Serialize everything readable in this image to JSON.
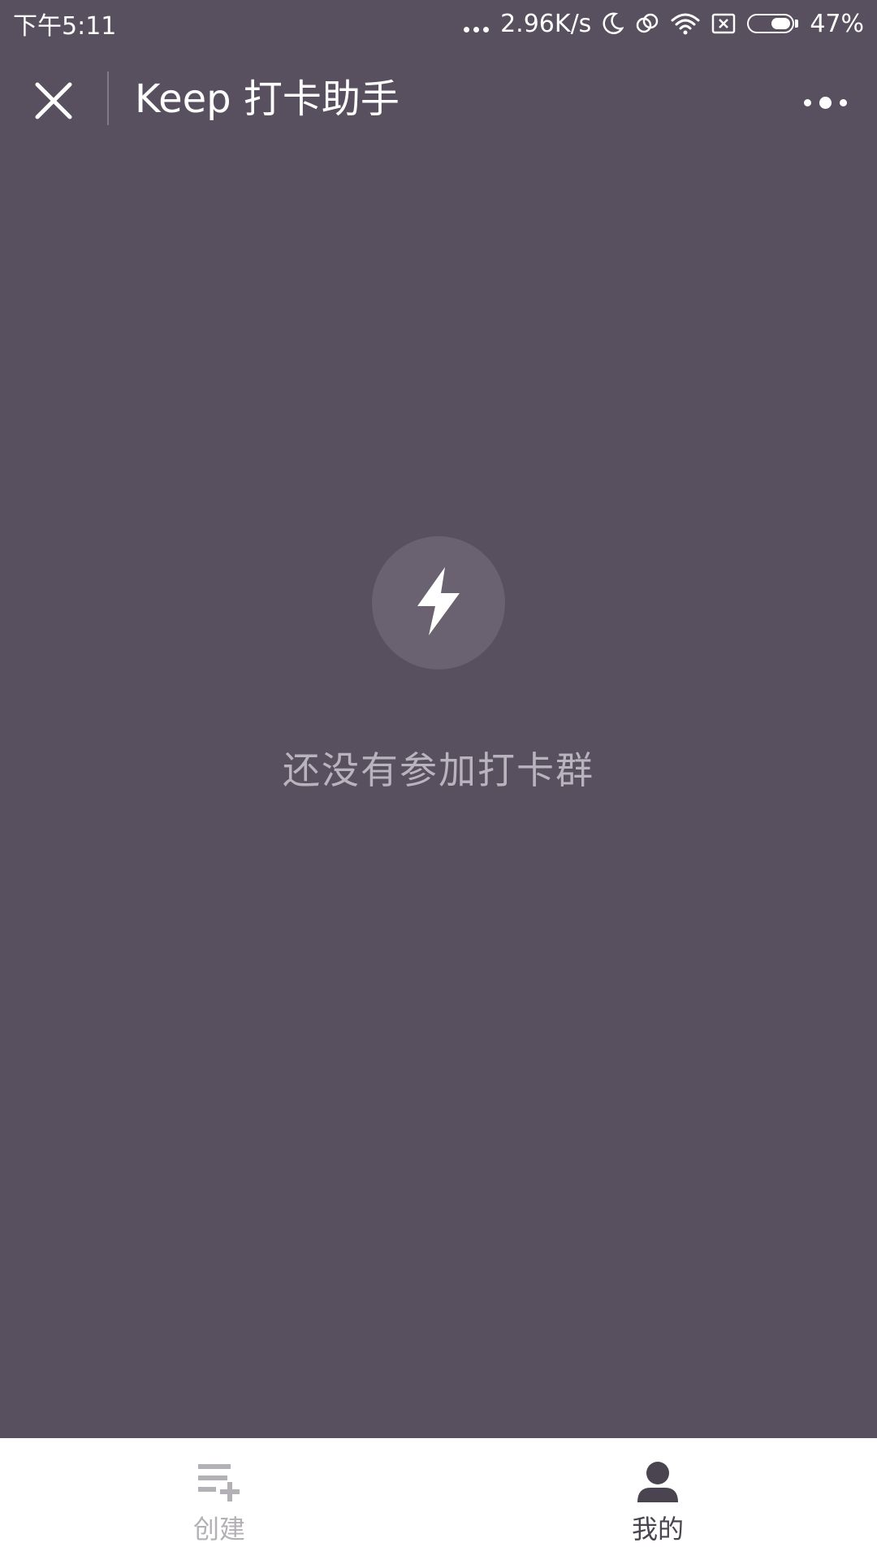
{
  "status_bar": {
    "time": "下午5:11",
    "network_speed": "2.96K/s",
    "battery_percent": "47%",
    "battery_level": 0.47,
    "icons": [
      "more-dots-icon",
      "moon-icon",
      "link-icon",
      "wifi-icon",
      "sim-off-icon",
      "battery-icon"
    ]
  },
  "nav": {
    "title": "Keep 打卡助手",
    "close_icon": "close-icon",
    "more_icon": "more-options-icon"
  },
  "empty_state": {
    "icon": "lightning-icon",
    "message": "还没有参加打卡群"
  },
  "tabs": [
    {
      "label": "创建",
      "icon": "create-list-icon",
      "active": false
    },
    {
      "label": "我的",
      "icon": "user-icon",
      "active": true
    }
  ],
  "colors": {
    "background": "#584f5f",
    "empty_circle": "#6b6271",
    "empty_text": "#b9b3bd",
    "tab_bar": "#ffffff",
    "tab_inactive": "#b3b0b6",
    "tab_active": "#4a4350"
  }
}
